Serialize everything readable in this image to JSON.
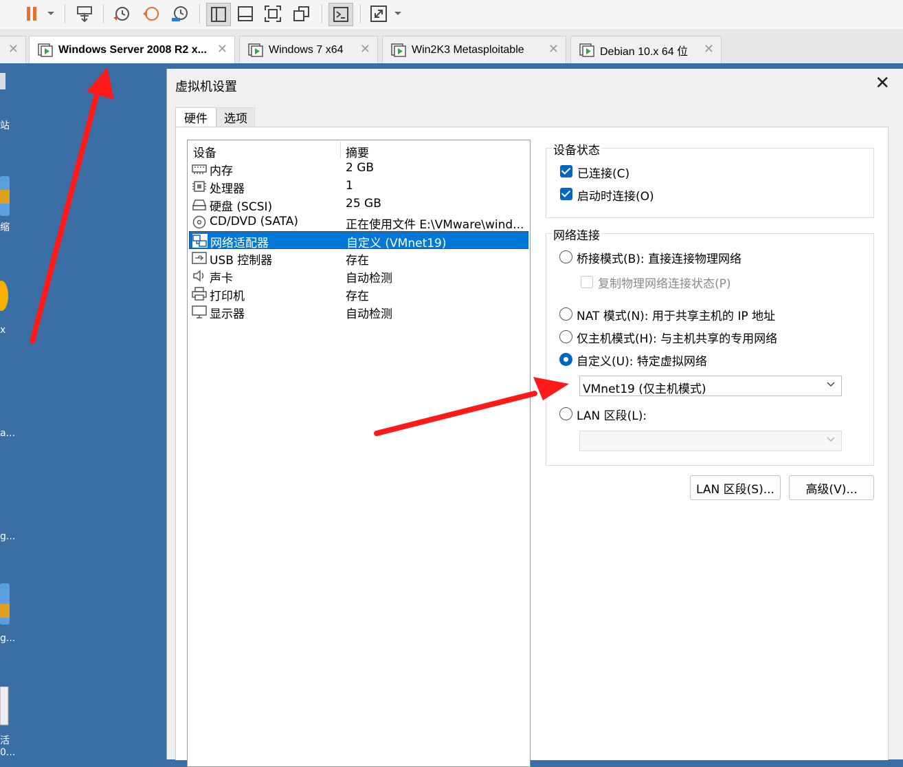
{
  "toolbar": {
    "icons": [
      "pause-icon",
      "dropdown-icon",
      "send-keys-icon",
      "snapshot-icon",
      "revert-icon",
      "snapshot-manager-icon",
      "library-view-icon",
      "console-view-icon",
      "fullscreen-icon",
      "unity-icon",
      "terminal-icon",
      "stretch-icon",
      "dropdown-icon"
    ]
  },
  "tabs": [
    {
      "label": "Windows Server 2008 R2 x...",
      "active": true
    },
    {
      "label": "Windows 7 x64",
      "active": false
    },
    {
      "label": "Win2K3 Metasploitable",
      "active": false
    },
    {
      "label": "Debian 10.x 64 位",
      "active": false
    }
  ],
  "desktop": {
    "labels": [
      "站",
      "缩",
      "x",
      "a...",
      "g...",
      "g...",
      "活",
      "0..."
    ]
  },
  "dialog": {
    "title": "虚拟机设置",
    "tabs": [
      "硬件",
      "选项"
    ],
    "device_list": {
      "headers": [
        "设备",
        "摘要"
      ],
      "rows": [
        {
          "name": "内存",
          "summary": "2 GB",
          "icon": "memory-icon"
        },
        {
          "name": "处理器",
          "summary": "1",
          "icon": "cpu-icon"
        },
        {
          "name": "硬盘 (SCSI)",
          "summary": "25 GB",
          "icon": "hard-disk-icon"
        },
        {
          "name": "CD/DVD (SATA)",
          "summary": "正在使用文件 E:\\VMware\\wind...",
          "icon": "cd-dvd-icon"
        },
        {
          "name": "网络适配器",
          "summary": "自定义 (VMnet19)",
          "icon": "network-adapter-icon",
          "selected": true
        },
        {
          "name": "USB 控制器",
          "summary": "存在",
          "icon": "usb-icon"
        },
        {
          "name": "声卡",
          "summary": "自动检测",
          "icon": "sound-icon"
        },
        {
          "name": "打印机",
          "summary": "存在",
          "icon": "printer-icon"
        },
        {
          "name": "显示器",
          "summary": "自动检测",
          "icon": "display-icon"
        }
      ]
    },
    "device_status": {
      "title": "设备状态",
      "connected": "已连接(C)",
      "connect_at_power_on": "启动时连接(O)"
    },
    "network": {
      "title": "网络连接",
      "bridged": "桥接模式(B): 直接连接物理网络",
      "replicate": "复制物理网络连接状态(P)",
      "nat": "NAT 模式(N): 用于共享主机的 IP 地址",
      "host_only": "仅主机模式(H): 与主机共享的专用网络",
      "custom": "自定义(U): 特定虚拟网络",
      "custom_value": "VMnet19 (仅主机模式)",
      "lan_segment": "LAN 区段(L):",
      "lan_segment_value": ""
    },
    "buttons": {
      "lan_segments": "LAN 区段(S)...",
      "advanced": "高级(V)..."
    }
  },
  "colors": {
    "accent": "#0067c0",
    "selection": "#0078d7",
    "arrow": "#ff1a1a",
    "desktop": "#3a6ea5"
  }
}
